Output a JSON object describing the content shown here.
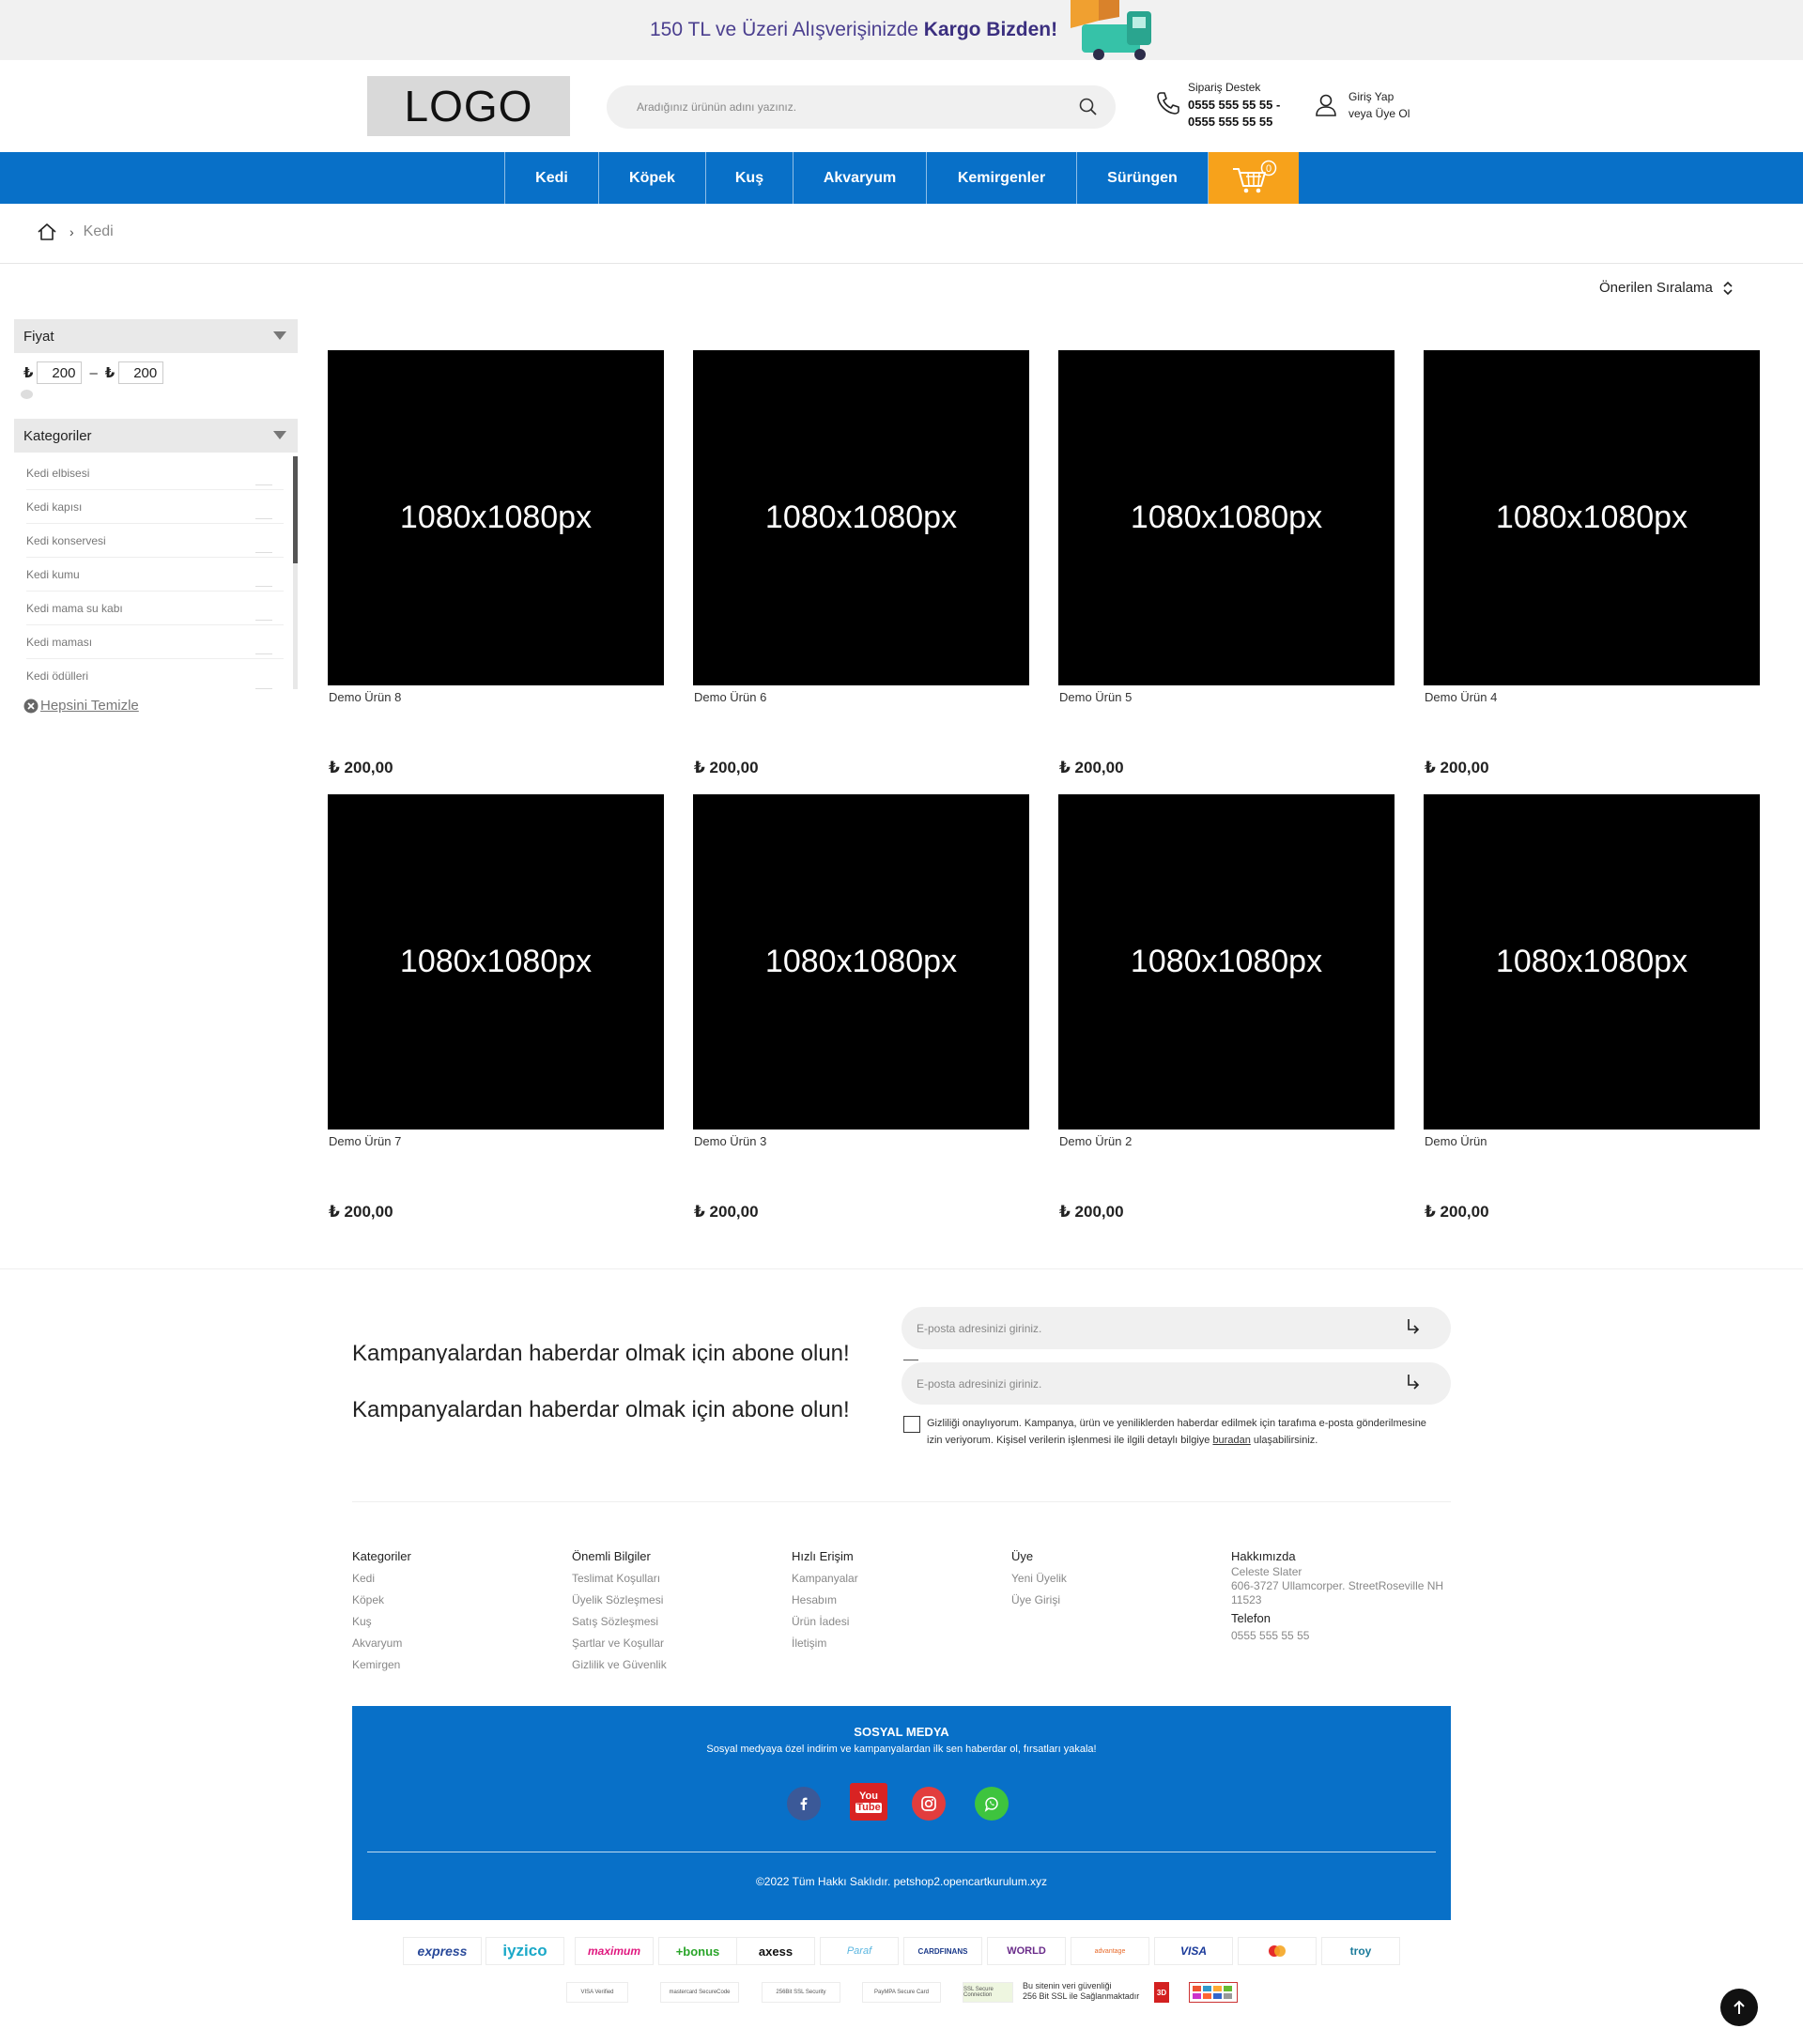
{
  "banner": {
    "text_prefix": "150 TL ve Üzeri Alışverişinizde ",
    "text_bold": "Kargo Bizden!"
  },
  "header": {
    "logo": "LOGO",
    "search_placeholder": "Aradığınız ürünün adını yazınız.",
    "support_label": "Sipariş Destek",
    "support_phone_1": "0555 555 55 55 -",
    "support_phone_2": "0555 555 55 55",
    "login_label": "Giriş Yap",
    "register_label": "veya Üye Ol"
  },
  "nav": {
    "items": [
      "Kedi",
      "Köpek",
      "Kuş",
      "Akvaryum",
      "Kemirgenler",
      "Sürüngen"
    ],
    "cart_count": "0"
  },
  "breadcrumb": {
    "current": "Kedi"
  },
  "sort": {
    "label": "Önerilen Sıralama"
  },
  "filters": {
    "price_title": "Fiyat",
    "currency": "₺",
    "price_min": "200",
    "price_max": "200",
    "categories_title": "Kategoriler",
    "categories": [
      "Kedi elbisesi",
      "Kedi kapısı",
      "Kedi konservesi",
      "Kedi kumu",
      "Kedi mama su kabı",
      "Kedi maması",
      "Kedi ödülleri"
    ],
    "clear_label": "Hepsini Temizle"
  },
  "products": [
    {
      "image_label": "1080x1080px",
      "name": "Demo Ürün 8",
      "price": "₺ 200,00"
    },
    {
      "image_label": "1080x1080px",
      "name": "Demo Ürün 6",
      "price": "₺ 200,00"
    },
    {
      "image_label": "1080x1080px",
      "name": "Demo Ürün 5",
      "price": "₺ 200,00"
    },
    {
      "image_label": "1080x1080px",
      "name": "Demo Ürün 4",
      "price": "₺ 200,00"
    },
    {
      "image_label": "1080x1080px",
      "name": "Demo Ürün 7",
      "price": "₺ 200,00"
    },
    {
      "image_label": "1080x1080px",
      "name": "Demo Ürün 3",
      "price": "₺ 200,00"
    },
    {
      "image_label": "1080x1080px",
      "name": "Demo Ürün 2",
      "price": "₺ 200,00"
    },
    {
      "image_label": "1080x1080px",
      "name": "Demo Ürün",
      "price": "₺ 200,00"
    }
  ],
  "newsletter": {
    "title": "Kampanyalardan haberdar olmak için abone olun!",
    "email_placeholder": "E-posta adresinizi giriniz.",
    "consent_text": "Gizliliği onaylıyorum. Kampanya, ürün ve yeniliklerden haberdar edilmek için tarafıma e-posta gönderilmesine izin veriyorum. Kişisel verilerin işlenmesi ile ilgili detaylı bilgiye ",
    "consent_link": "buradan",
    "consent_suffix": " ulaşabilirsiniz."
  },
  "footer": {
    "col_categories": {
      "title": "Kategoriler",
      "links": [
        "Kedi",
        "Köpek",
        "Kuş",
        "Akvaryum",
        "Kemirgen"
      ]
    },
    "col_info": {
      "title": "Önemli Bilgiler",
      "links": [
        "Teslimat Koşulları",
        "Üyelik Sözleşmesi",
        "Satış Sözleşmesi",
        "Şartlar ve Koşullar",
        "Gizlilik ve Güvenlik"
      ]
    },
    "col_quick": {
      "title": "Hızlı Erişim",
      "links": [
        "Kampanyalar",
        "Hesabım",
        "Ürün İadesi",
        "İletişim"
      ]
    },
    "col_member": {
      "title": "Üye",
      "links": [
        "Yeni Üyelik",
        "Üye Girişi"
      ]
    },
    "col_about": {
      "title": "Hakkımızda",
      "name": "Celeste Slater",
      "address": "606-3727 Ullamcorper. StreetRoseville NH 11523",
      "phone_title": "Telefon",
      "phone": "0555 555 55 55"
    }
  },
  "social": {
    "title": "SOSYAL MEDYA",
    "subtitle": "Sosyal medyaya özel indirim ve kampanyalardan ilk sen haberdar ol, fırsatları yakala!",
    "youtube_top": "You",
    "youtube_bottom": "Tube",
    "copyright": "©2022 Tüm Hakkı Saklıdır. petshop2.opencartkurulum.xyz"
  },
  "payments": [
    "express",
    "iyzico",
    "maximum",
    "+bonus",
    "axess",
    "Paraf",
    "CARDFINANS",
    "WORLD",
    "advantage",
    "VISA",
    "mastercard",
    "troy"
  ],
  "security": [
    "VISA Verified",
    "mastercard SecureCode",
    "256Bit SSL Security",
    "PayMPA Secure Card",
    "SSL Secure Connection"
  ],
  "ssl_note_1": "Bu sitenin veri güvenliği",
  "ssl_note_2": "256 Bit SSL ile Sağlanmaktadır",
  "three_d": "3D",
  "colors": {
    "brand_blue": "#0870c8",
    "cart_orange": "#f7a21b",
    "banner_text": "#4b3f8f"
  }
}
